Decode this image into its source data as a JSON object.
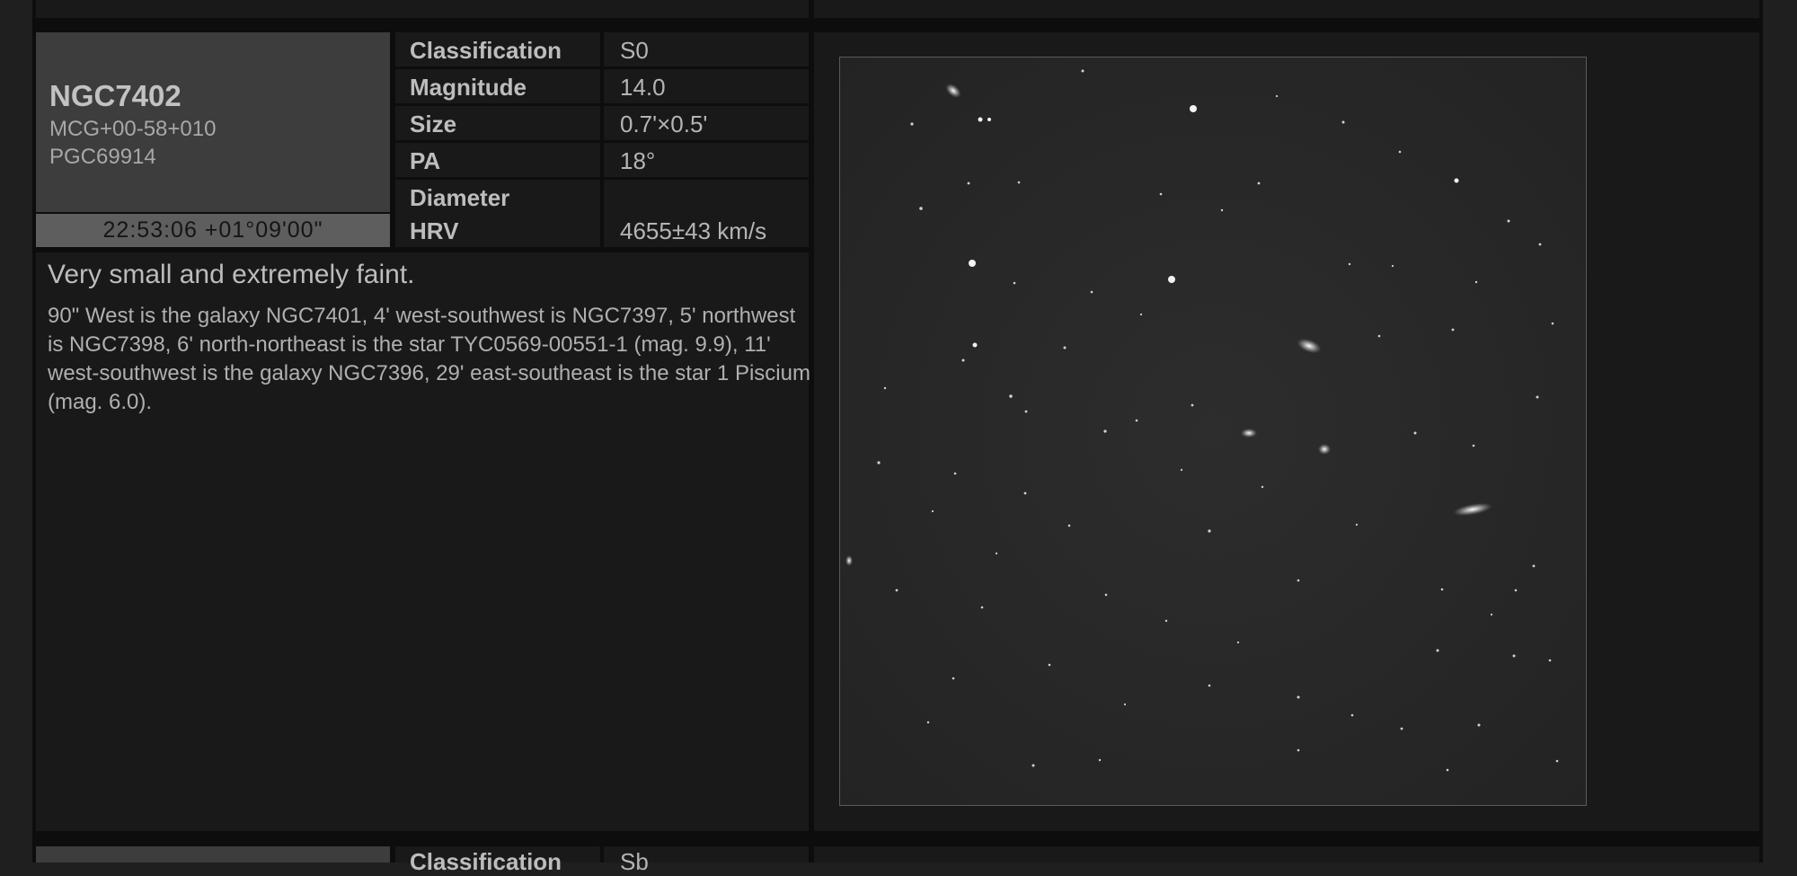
{
  "object": {
    "name": "NGC7402",
    "aliases": [
      "MCG+00-58+010",
      "PGC69914"
    ],
    "coordinates": "22:53:06 +01°09'00\""
  },
  "properties": [
    {
      "label": "Classification",
      "value": "S0"
    },
    {
      "label": "Magnitude",
      "value": "14.0"
    },
    {
      "label": "Size",
      "value": "0.7'×0.5'"
    },
    {
      "label": "PA",
      "value": "18°"
    },
    {
      "label": "Diameter",
      "value": ""
    },
    {
      "label": "HRV",
      "value": "4655±43 km/s"
    }
  ],
  "description": {
    "headline": "Very small and extremely faint.",
    "text": "90\" West is the galaxy NGC7401, 4' west-southwest is NGC7397, 5' northwest is NGC7398, 6' north-northeast is the star TYC0569-00551-1 (mag. 9.9), 11' west-southwest is the galaxy NGC7396, 29' east-southeast is the star 1 Piscium (mag. 6.0)."
  },
  "next_entry": {
    "first_property": {
      "label": "Classification",
      "value": "Sb"
    }
  }
}
